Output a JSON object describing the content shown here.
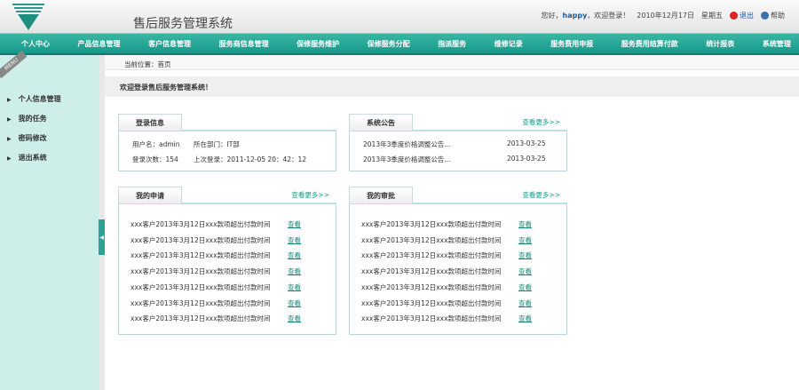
{
  "header": {
    "title": "售后服务管理系统",
    "greeting_prefix": "您好，",
    "user": "happy",
    "greeting_suffix": "，欢迎登录！",
    "date": "2010年12月17日",
    "weekday": "星期五",
    "logout": "退出",
    "help": "帮助"
  },
  "nav": [
    "个人中心",
    "产品信息管理",
    "客户信息管理",
    "服务商信息管理",
    "保修服务维护",
    "保修服务分配",
    "指派服务",
    "维修记录",
    "服务费用申报",
    "服务费用结算付款",
    "统计报表",
    "系统管理"
  ],
  "sidebar": {
    "tag": "MENU",
    "items": [
      "个人信息管理",
      "我的任务",
      "密码修改",
      "退出系统"
    ]
  },
  "breadcrumb": "当前位置：首页",
  "welcome": "欢迎登录售后服务管理系统！",
  "login_info": {
    "title": "登录信息",
    "username": "用户名：admin",
    "dept": "所在部门：IT部",
    "count": "登录次数：154",
    "last": "上次登录：2011-12-05 20：42：12"
  },
  "notice": {
    "title": "系统公告",
    "more": "查看更多>>",
    "items": [
      {
        "text": "2013年3季度价格调整公告...",
        "date": "2013-03-25"
      },
      {
        "text": "2013年3季度价格调整公告...",
        "date": "2013-03-25"
      }
    ]
  },
  "my_apply": {
    "title": "我的申请",
    "more": "查看更多>>",
    "link": "查看",
    "items": [
      "xxx客户2013年3月12日xxx款项超出付款时间",
      "xxx客户2013年3月12日xxx款项超出付款时间",
      "xxx客户2013年3月12日xxx款项超出付款时间",
      "xxx客户2013年3月12日xxx款项超出付款时间",
      "xxx客户2013年3月12日xxx款项超出付款时间",
      "xxx客户2013年3月12日xxx款项超出付款时间",
      "xxx客户2013年3月12日xxx款项超出付款时间"
    ]
  },
  "my_approve": {
    "title": "我的审批",
    "more": "查看更多>>",
    "link": "查看",
    "items": [
      "xxx客户2013年3月12日xxx款项超出付款时间",
      "xxx客户2013年3月12日xxx款项超出付款时间",
      "xxx客户2013年3月12日xxx款项超出付款时间",
      "xxx客户2013年3月12日xxx款项超出付款时间",
      "xxx客户2013年3月12日xxx款项超出付款时间",
      "xxx客户2013年3月12日xxx款项超出付款时间",
      "xxx客户2013年3月12日xxx款项超出付款时间"
    ]
  }
}
